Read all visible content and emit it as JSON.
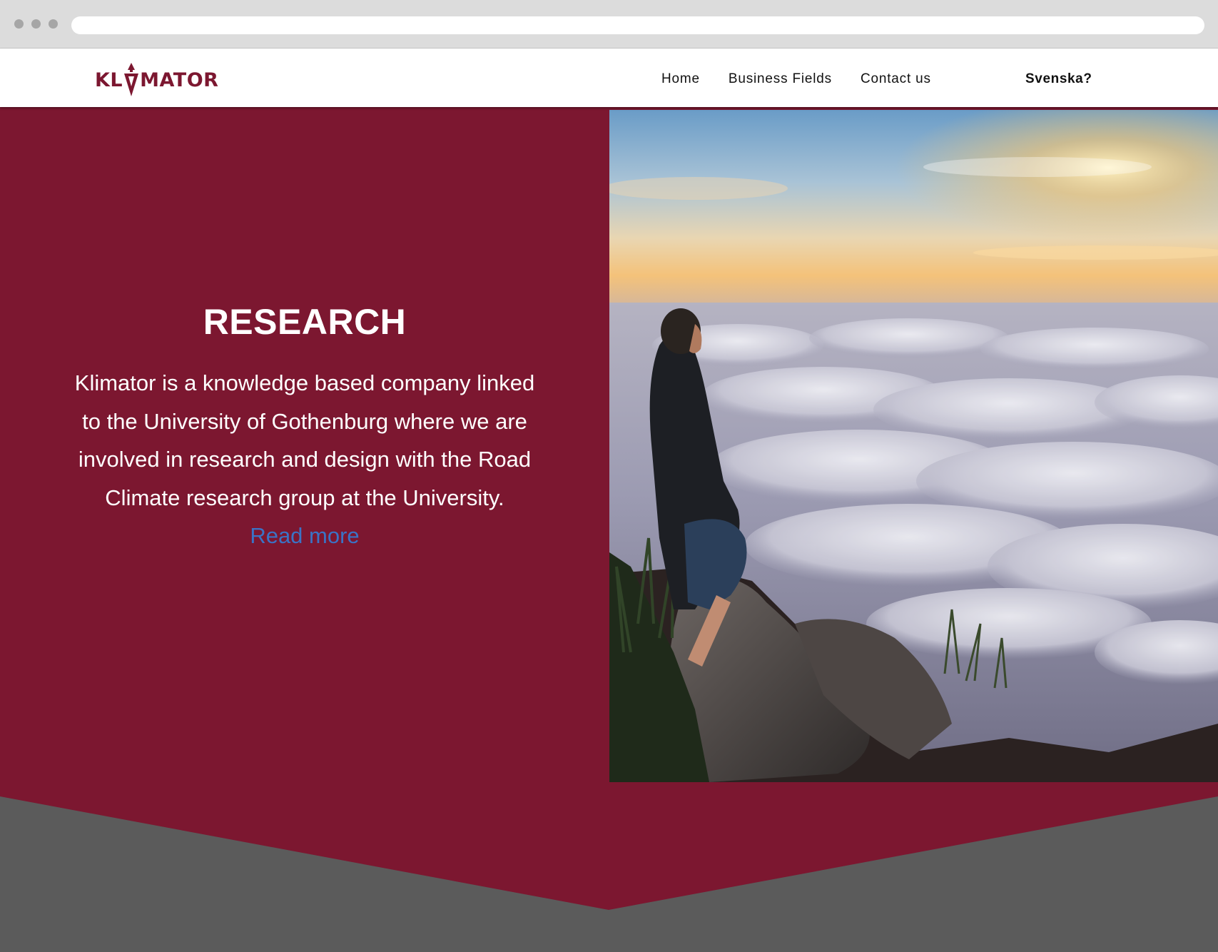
{
  "browser": {
    "window_dots": 3
  },
  "header": {
    "logo": {
      "left": "KL",
      "right": "MATOR",
      "alt": "KLIMATOR"
    },
    "nav": [
      {
        "label": "Home"
      },
      {
        "label": "Business Fields"
      },
      {
        "label": "Contact us"
      }
    ],
    "language_link": "Svenska?"
  },
  "hero": {
    "title": "RESEARCH",
    "text": "Klimator is a knowledge based company linked to the University of Gothenburg where we are involved in research and design with the Road Climate research group at the University.",
    "read_more": "Read more",
    "photo_subject": "person-sitting-on-rock-above-clouds"
  },
  "colors": {
    "brand": "#7c1730",
    "link": "#3a73c6",
    "footer_gray": "#5b5b5b",
    "header_bg": "#ffffff"
  }
}
